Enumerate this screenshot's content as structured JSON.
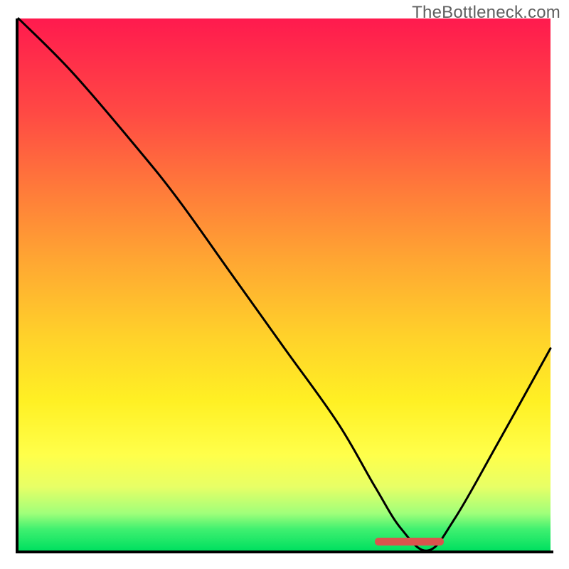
{
  "watermark": "TheBottleneck.com",
  "chart_data": {
    "type": "line",
    "title": "",
    "xlabel": "",
    "ylabel": "",
    "xlim": [
      0,
      100
    ],
    "ylim": [
      0,
      100
    ],
    "grid": false,
    "legend": false,
    "background_gradient": {
      "orientation": "vertical",
      "stops": [
        {
          "pos": 0,
          "color": "#ff1a4e"
        },
        {
          "pos": 50,
          "color": "#ffb030"
        },
        {
          "pos": 80,
          "color": "#ffff40"
        },
        {
          "pos": 100,
          "color": "#00e060"
        }
      ]
    },
    "series": [
      {
        "name": "bottleneck-curve",
        "x": [
          0,
          10,
          22,
          30,
          40,
          50,
          60,
          67,
          72,
          77,
          82,
          90,
          100
        ],
        "values": [
          100,
          90,
          76,
          66,
          52,
          38,
          24,
          12,
          4,
          0,
          6,
          20,
          38
        ]
      }
    ],
    "optimal_marker": {
      "x_start": 67,
      "x_end": 80,
      "y": 0,
      "color": "#d9544d"
    }
  }
}
